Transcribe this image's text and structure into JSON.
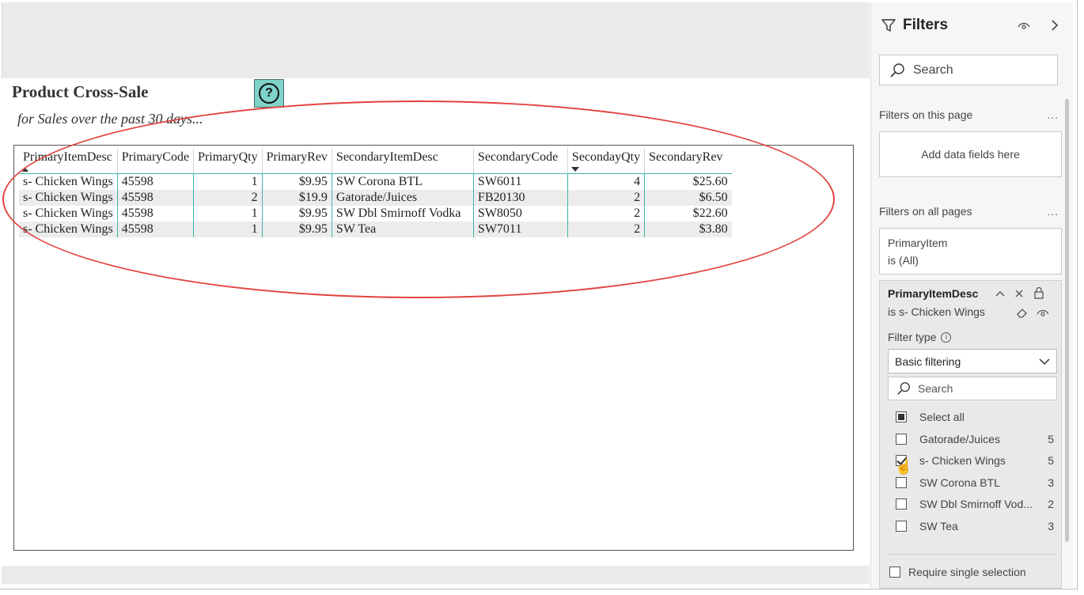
{
  "report": {
    "title": "Product Cross-Sale",
    "subtitle": "for Sales over the past 30 days...",
    "help_icon": "question-circle-icon"
  },
  "table": {
    "columns": [
      "PrimaryItemDesc",
      "PrimaryCode",
      "PrimaryQty",
      "PrimaryRev",
      "SecondaryItemDesc",
      "SecondaryCode",
      "SecondayQty",
      "SecondaryRev"
    ],
    "rows": [
      [
        "s- Chicken Wings",
        "45598",
        "1",
        "$9.95",
        "SW Corona BTL",
        "SW6011",
        "4",
        "$25.60"
      ],
      [
        "s- Chicken Wings",
        "45598",
        "2",
        "$19.9",
        "Gatorade/Juices",
        "FB20130",
        "2",
        "$6.50"
      ],
      [
        "s- Chicken Wings",
        "45598",
        "1",
        "$9.95",
        "SW Dbl Smirnoff Vodka",
        "SW8050",
        "2",
        "$22.60"
      ],
      [
        "s- Chicken Wings",
        "45598",
        "1",
        "$9.95",
        "SW Tea",
        "SW7011",
        "2",
        "$3.80"
      ]
    ]
  },
  "filters": {
    "title": "Filters",
    "search_placeholder": "Search",
    "on_this_page_label": "Filters on this page",
    "add_fields_label": "Add data fields here",
    "on_all_pages_label": "Filters on all pages",
    "dots": "...",
    "card1": {
      "name": "PrimaryItem",
      "state": "is (All)"
    },
    "card2": {
      "name": "PrimaryItemDesc",
      "state": "is s- Chicken Wings",
      "filter_type_label": "Filter type",
      "filter_type_value": "Basic filtering",
      "search_placeholder": "Search",
      "select_all": "Select all",
      "options": [
        {
          "label": "Gatorade/Juices",
          "count": "5",
          "checked": false
        },
        {
          "label": "s- Chicken Wings",
          "count": "5",
          "checked": true
        },
        {
          "label": "SW Corona BTL",
          "count": "3",
          "checked": false
        },
        {
          "label": "SW Dbl Smirnoff Vod...",
          "count": "2",
          "checked": false
        },
        {
          "label": "SW Tea",
          "count": "3",
          "checked": false
        }
      ],
      "require_single": "Require single selection"
    }
  },
  "colors": {
    "accent_teal": "#41b4a8",
    "annotation_red": "#e2433f",
    "help_bg": "#7fd3c9"
  }
}
